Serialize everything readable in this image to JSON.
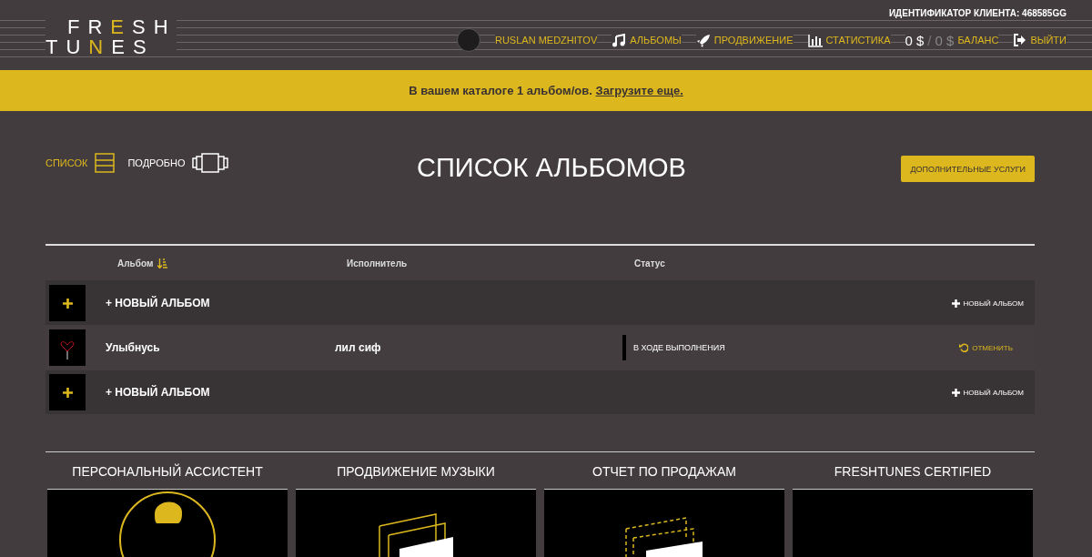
{
  "header": {
    "logo": [
      "FRESH",
      "TUNES"
    ],
    "client_id": "ИДЕНТИФИКАТОР КЛИЕНТА: 468585GG",
    "user": "RUSLAN MEDZHITOV",
    "nav": [
      {
        "kind": "music",
        "label": "АЛЬБОМЫ"
      },
      {
        "kind": "rocket",
        "label": "ПРОДВИЖЕНИЕ"
      },
      {
        "kind": "chart",
        "label": "СТАТИСТИКА"
      }
    ],
    "balance": {
      "amount": "0 $",
      "separator": "/",
      "second": "0 $",
      "label": "БАЛАНС"
    },
    "logout": "ВЫЙТИ"
  },
  "banner": {
    "text": "В вашем каталоге 1 альбом/ов.",
    "link": "Загрузите еще."
  },
  "views": [
    {
      "label": "СПИСОК",
      "kind": "list",
      "selected": true
    },
    {
      "label": "ПОДРОБНО",
      "kind": "detail",
      "selected": false
    }
  ],
  "title": "СПИСОК АЛЬБОМОВ",
  "extra_button": "ДОПОЛНИТЕЛЬНЫЕ УСЛУГИ",
  "table": {
    "columns": [
      "Альбом",
      "Исполнитель",
      "Статус"
    ],
    "rows": [
      {
        "kind": "new",
        "label": "+ НОВЫЙ АЛЬБОМ",
        "action": "НОВЫЙ АЛЬБОМ"
      },
      {
        "kind": "album",
        "album": "Улыбнусь",
        "artist": "лил сиф",
        "status": "В ХОДЕ ВЫПОЛНЕНИЯ",
        "action": "ОТМЕНИТЬ"
      },
      {
        "kind": "new",
        "label": "+ НОВЫЙ АЛЬБОМ",
        "action": "НОВЫЙ АЛЬБОМ"
      }
    ]
  },
  "services": [
    {
      "title": "ПЕРСОНАЛЬНЫЙ АССИСТЕНТ",
      "kind": "assistant"
    },
    {
      "title": "ПРОДВИЖЕНИЕ МУЗЫКИ",
      "kind": "promo"
    },
    {
      "title": "ОТЧЕТ ПО ПРОДАЖАМ",
      "kind": "report"
    },
    {
      "title": "FRESHTUNES CERTIFIED",
      "kind": "certified"
    }
  ]
}
